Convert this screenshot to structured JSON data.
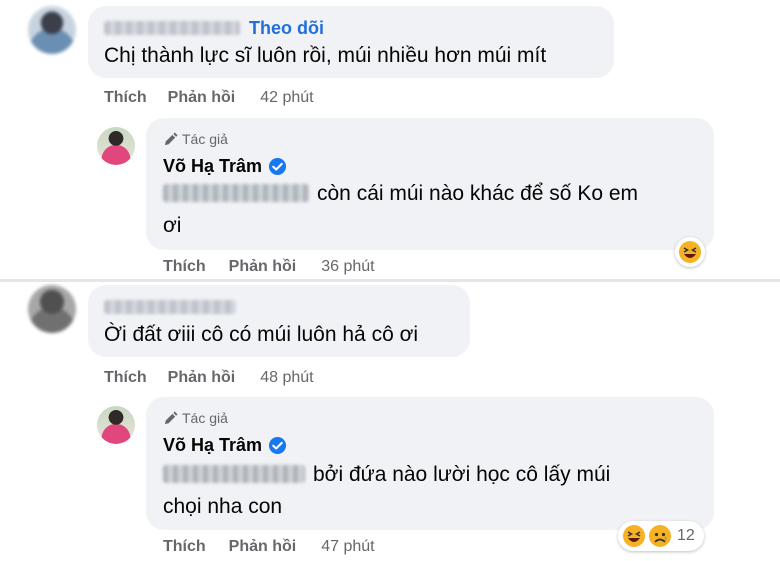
{
  "comments": [
    {
      "follow_label": "Theo dõi",
      "text": "Chị thành lực sĩ luôn rồi, múi nhiều hơn múi mít",
      "actions": {
        "like": "Thích",
        "reply": "Phản hồi",
        "time": "42 phút"
      },
      "reply": {
        "author_tag": "Tác giả",
        "author_name": "Võ Hạ Trâm",
        "text_line1": "còn cái múi nào khác để số Ko em",
        "text_line2": "ơi",
        "actions": {
          "like": "Thích",
          "reply": "Phản hồi",
          "time": "36 phút"
        },
        "reactions": [
          "laughing-emoji"
        ]
      }
    },
    {
      "text": "Ời đất ơiii cô có múi luôn hả cô ơi",
      "actions": {
        "like": "Thích",
        "reply": "Phản hồi",
        "time": "48 phút"
      },
      "reply": {
        "author_tag": "Tác giả",
        "author_name": "Võ Hạ Trâm",
        "text_line1": "bởi đứa nào lười học cô lấy múi",
        "text_line2": "chọi nha con",
        "actions": {
          "like": "Thích",
          "reply": "Phản hồi",
          "time": "47 phút"
        },
        "reactions": [
          "laughing-emoji",
          "sad-emoji"
        ],
        "reaction_count": "12"
      }
    }
  ],
  "colors": {
    "bubble": "#f0f2f5",
    "link": "#216fdb",
    "meta": "#65676b",
    "verified": "#1877f2"
  }
}
